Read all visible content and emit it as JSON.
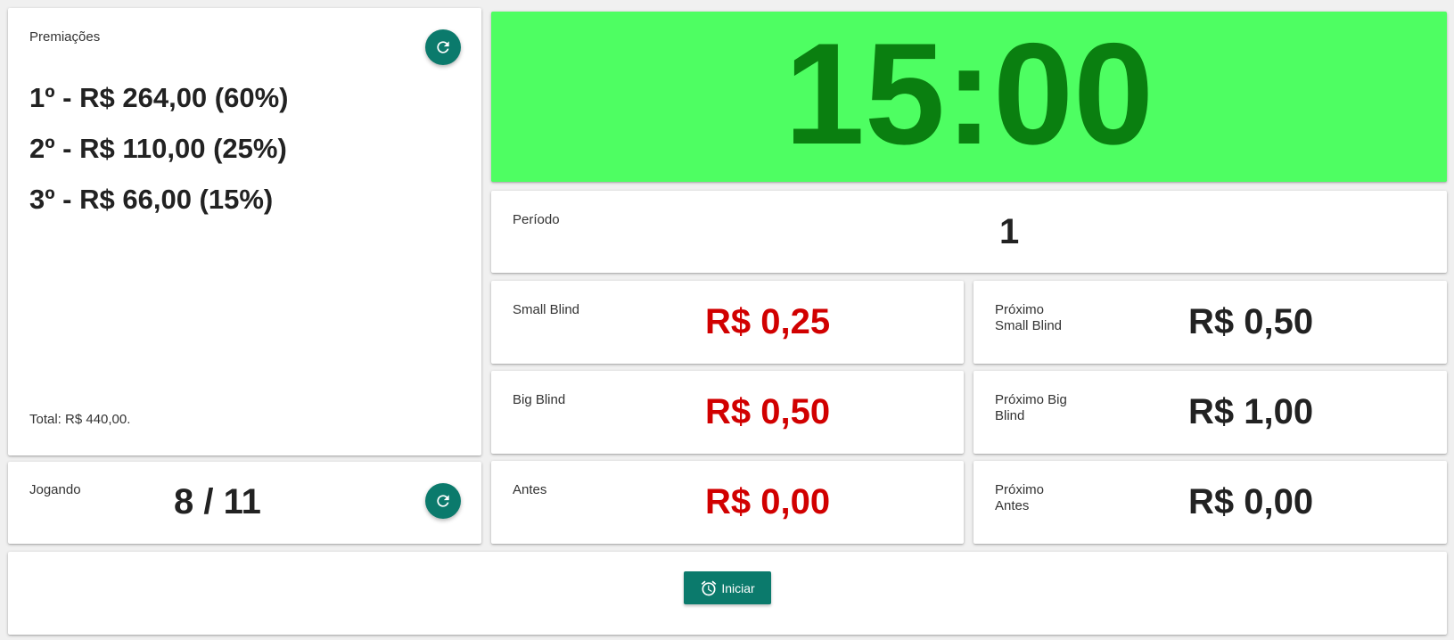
{
  "prizes": {
    "title": "Premiações",
    "items": [
      "1º - R$ 264,00 (60%)",
      "2º - R$ 110,00 (25%)",
      "3º - R$ 66,00 (15%)"
    ],
    "total": "Total: R$ 440,00."
  },
  "players": {
    "label": "Jogando",
    "value": "8 / 11"
  },
  "timer": {
    "value": "15:00"
  },
  "period": {
    "label": "Período",
    "value": "1"
  },
  "small_blind": {
    "label": "Small Blind",
    "value": "R$ 0,25"
  },
  "next_small_blind": {
    "label_line1": "Próximo",
    "label_line2": "Small Blind",
    "value": "R$ 0,50"
  },
  "big_blind": {
    "label": "Big Blind",
    "value": "R$ 0,50"
  },
  "next_big_blind": {
    "label_line1": "Próximo Big",
    "label_line2": "Blind",
    "value": "R$ 1,00"
  },
  "antes": {
    "label": "Antes",
    "value": "R$ 0,00"
  },
  "next_antes": {
    "label_line1": "Próximo",
    "label_line2": "Antes",
    "value": "R$ 0,00"
  },
  "controls": {
    "start_label": "Iniciar"
  },
  "icons": {
    "refresh": "refresh-icon",
    "alarm": "alarm-clock-icon"
  },
  "colors": {
    "timer_background": "#4efe62",
    "timer_text": "#0a7f10",
    "accent": "#0b7a6c",
    "current_value": "#d10000"
  }
}
